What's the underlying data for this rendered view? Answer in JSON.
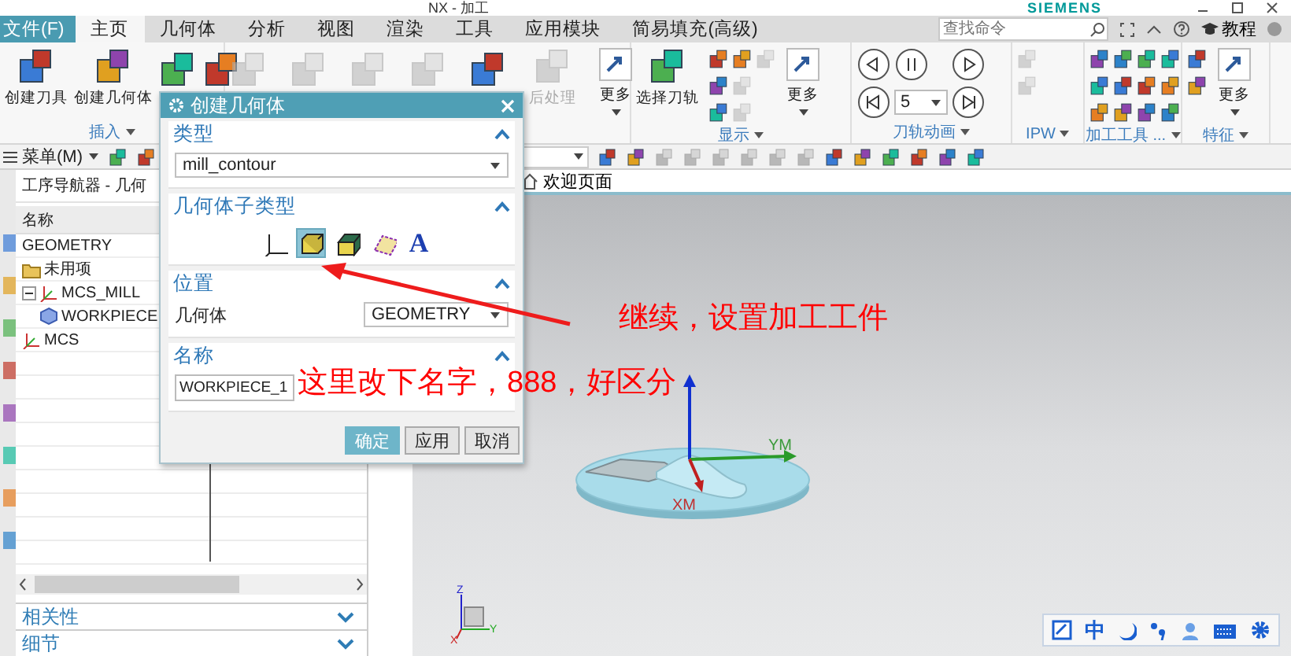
{
  "title_bar": {
    "title": "NX - 加工",
    "brand": "SIEMENS"
  },
  "menu_tabs": [
    {
      "label": "文件(F)",
      "kind": "file",
      "selected": false
    },
    {
      "label": "主页",
      "kind": "tab",
      "selected": true
    },
    {
      "label": "几何体",
      "kind": "tab",
      "selected": false
    },
    {
      "label": "分析",
      "kind": "tab",
      "selected": false
    },
    {
      "label": "视图",
      "kind": "tab",
      "selected": false
    },
    {
      "label": "渲染",
      "kind": "tab",
      "selected": false
    },
    {
      "label": "工具",
      "kind": "tab",
      "selected": false
    },
    {
      "label": "应用模块",
      "kind": "tab",
      "selected": false
    },
    {
      "label": "简易填充(高级)",
      "kind": "tab",
      "selected": false
    }
  ],
  "search": {
    "placeholder": "查找命令"
  },
  "help_button": {
    "label": "教程"
  },
  "ribbon_groups": [
    {
      "label": "插入",
      "items": [
        {
          "kind": "large",
          "label": "创建刀具",
          "disabled": false
        },
        {
          "kind": "large",
          "label": "创建几何体",
          "disabled": false
        },
        {
          "kind": "big",
          "disabled": false
        },
        {
          "kind": "big",
          "disabled": false
        }
      ]
    },
    {
      "items": [
        {
          "kind": "big",
          "disabled": true
        },
        {
          "kind": "big",
          "disabled": true
        },
        {
          "kind": "big",
          "disabled": true
        },
        {
          "kind": "big",
          "disabled": true
        },
        {
          "kind": "big",
          "disabled": false
        },
        {
          "kind": "large",
          "label": "后处理",
          "disabled": true
        },
        {
          "kind": "more",
          "label": "更多",
          "disabled": false
        }
      ]
    },
    {
      "label": "显示",
      "items": [
        {
          "kind": "large",
          "label": "选择刀轨",
          "disabled": false
        },
        {
          "kind": "small",
          "disabled": false
        },
        {
          "kind": "small",
          "disabled": false
        },
        {
          "kind": "small",
          "disabled": false
        },
        {
          "kind": "small",
          "disabled": false
        },
        {
          "kind": "small",
          "disabled": true
        },
        {
          "kind": "small",
          "disabled": true
        },
        {
          "kind": "small",
          "disabled": true
        },
        {
          "kind": "more",
          "label": "更多",
          "disabled": false
        }
      ]
    },
    {
      "label": "刀轨动画",
      "items": [
        {
          "kind": "round",
          "disabled": false
        },
        {
          "kind": "round",
          "disabled": false
        },
        {
          "kind": "round",
          "disabled": false
        },
        {
          "kind": "select",
          "value": "5",
          "disabled": false
        },
        {
          "kind": "round",
          "disabled": false
        },
        {
          "kind": "round",
          "disabled": false
        }
      ]
    },
    {
      "label": "IPW",
      "items": [
        {
          "kind": "small",
          "disabled": true
        },
        {
          "kind": "small",
          "disabled": true
        }
      ]
    },
    {
      "label": "加工工具 ...",
      "items": [
        {
          "kind": "small",
          "disabled": false
        },
        {
          "kind": "small",
          "disabled": false
        },
        {
          "kind": "small",
          "disabled": false
        },
        {
          "kind": "small",
          "disabled": false
        },
        {
          "kind": "small",
          "disabled": false
        },
        {
          "kind": "small",
          "disabled": false
        },
        {
          "kind": "small",
          "disabled": false
        },
        {
          "kind": "small",
          "disabled": false
        },
        {
          "kind": "small",
          "disabled": false
        },
        {
          "kind": "small",
          "disabled": false
        },
        {
          "kind": "small",
          "disabled": false
        },
        {
          "kind": "small",
          "disabled": false
        }
      ]
    },
    {
      "label": "特征",
      "items": [
        {
          "kind": "small",
          "disabled": false
        },
        {
          "kind": "small",
          "disabled": false
        },
        {
          "kind": "more",
          "label": "更多",
          "disabled": false
        }
      ]
    }
  ],
  "menu_button": {
    "label": "菜单(M)"
  },
  "navigator": {
    "title": "工序导航器 - 几何",
    "column": "名称",
    "tree": [
      {
        "label": "GEOMETRY",
        "children": [
          {
            "label": "未用项",
            "kind": "folder"
          },
          {
            "label": "MCS_MILL",
            "kind": "mcs",
            "expanded": true,
            "children": [
              {
                "label": "WORKPIECE",
                "kind": "workpiece"
              }
            ]
          },
          {
            "label": "MCS",
            "kind": "mcs"
          }
        ]
      }
    ],
    "sections": [
      {
        "label": "相关性",
        "expanded": false
      },
      {
        "label": "细节",
        "expanded": false
      }
    ]
  },
  "viewport": {
    "tab": "欢迎页面",
    "axes": [
      {
        "label": "YM"
      },
      {
        "label": "XM"
      }
    ],
    "triad": [
      "Z",
      "Y",
      "X"
    ]
  },
  "ime_bar": {
    "mode": "中"
  },
  "dialog": {
    "title": "创建几何体",
    "sections": [
      {
        "kind": "dropdown",
        "title": "类型",
        "expanded": true,
        "value": "mill_contour"
      },
      {
        "kind": "subtypes",
        "title": "几何体子类型",
        "expanded": true,
        "options": [
          {
            "selected": false
          },
          {
            "selected": true
          },
          {
            "selected": false
          },
          {
            "selected": false
          },
          {
            "label": "A",
            "selected": false
          }
        ]
      },
      {
        "kind": "field",
        "title": "位置",
        "expanded": true,
        "label": "几何体",
        "value": "GEOMETRY"
      },
      {
        "kind": "input",
        "title": "名称",
        "expanded": true,
        "value": "WORKPIECE_1"
      }
    ],
    "buttons": [
      {
        "label": "确定",
        "kind": "primary"
      },
      {
        "label": "应用",
        "kind": "normal"
      },
      {
        "label": "取消",
        "kind": "normal"
      }
    ]
  },
  "annotations": [
    {
      "text": "继续，设置加工工件"
    },
    {
      "text": "这里改下名字，888，好区分"
    }
  ]
}
